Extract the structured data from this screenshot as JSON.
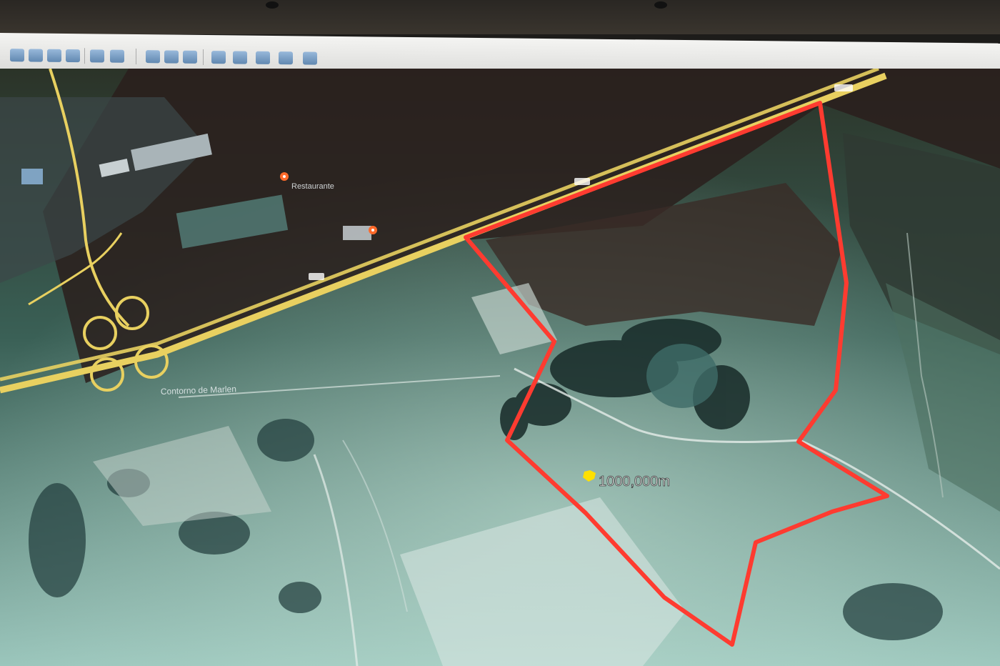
{
  "toolbar": {
    "buttons": [
      {
        "name": "hide-sidebar-icon"
      },
      {
        "name": "add-placemark-icon"
      },
      {
        "name": "add-polygon-icon"
      },
      {
        "name": "add-path-icon"
      },
      {
        "name": "add-image-overlay-icon"
      },
      {
        "name": "record-tour-icon"
      },
      {
        "name": "historical-imagery-icon"
      },
      {
        "name": "sun-icon"
      },
      {
        "name": "planets-icon"
      },
      {
        "name": "ruler-icon"
      },
      {
        "name": "email-icon"
      },
      {
        "name": "print-icon"
      },
      {
        "name": "save-image-icon"
      },
      {
        "name": "view-in-maps-icon"
      }
    ]
  },
  "map": {
    "area_label": "1000,000m",
    "road_shields": [
      "",
      "",
      ""
    ],
    "places": [
      {
        "name": "Restaurante"
      },
      {
        "name": ""
      }
    ],
    "road_label": "Contorno de Marlen",
    "colors": {
      "boundary": "#ff3b30",
      "highway": "#e8d060",
      "pin": "#ff6a2a",
      "area_marker": "#ffe000"
    }
  }
}
